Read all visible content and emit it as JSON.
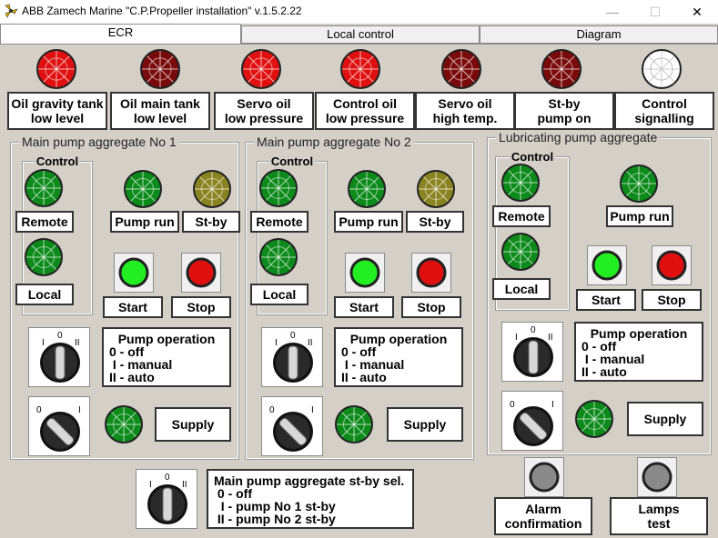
{
  "window": {
    "title": "ABB Zamech Marine \"C.P.Propeller installation\" v.1.5.2.22",
    "minimize": "—",
    "maximize": "☐",
    "close": "✕"
  },
  "tabs": [
    {
      "label": "ECR"
    },
    {
      "label": "Local control"
    },
    {
      "label": "Diagram"
    }
  ],
  "alarms": [
    {
      "label1": "Oil gravity tank",
      "label2": "low level",
      "color": "#e01010"
    },
    {
      "label1": "Oil main tank",
      "label2": "low level",
      "color": "#7a0a0a"
    },
    {
      "label1": "Servo oil",
      "label2": "low pressure",
      "color": "#e01010"
    },
    {
      "label1": "Control oil",
      "label2": "low pressure",
      "color": "#e01010"
    },
    {
      "label1": "Servo oil",
      "label2": "high temp.",
      "color": "#7a0a0a"
    },
    {
      "label1": "St-by",
      "label2": "pump on",
      "color": "#7a0a0a"
    },
    {
      "label1": "Control",
      "label2": "signalling",
      "color": "#ffffff"
    }
  ],
  "pump1": {
    "title": "Main pump aggregate No 1",
    "control": "Control",
    "remote": "Remote",
    "local": "Local",
    "pump_run": "Pump run",
    "stby": "St-by",
    "start": "Start",
    "stop": "Stop",
    "op_title": "Pump operation",
    "op_lines": [
      "0 - off",
      " I - manual",
      "II - auto"
    ],
    "supply": "Supply",
    "switch_labels": [
      "I",
      "0",
      "II"
    ],
    "switch2_labels": [
      "0",
      "I"
    ]
  },
  "pump2": {
    "title": "Main pump aggregate No 2",
    "control": "Control",
    "remote": "Remote",
    "local": "Local",
    "pump_run": "Pump run",
    "stby": "St-by",
    "start": "Start",
    "stop": "Stop",
    "op_title": "Pump operation",
    "op_lines": [
      "0 - off",
      " I - manual",
      "II - auto"
    ],
    "supply": "Supply",
    "switch_labels": [
      "I",
      "0",
      "II"
    ],
    "switch2_labels": [
      "0",
      "I"
    ]
  },
  "lube": {
    "title": "Lubricating pump aggregate",
    "control": "Control",
    "remote": "Remote",
    "local": "Local",
    "pump_run": "Pump run",
    "start": "Start",
    "stop": "Stop",
    "op_title": "Pump operation",
    "op_lines": [
      "0 - off",
      " I - manual",
      "II - auto"
    ],
    "supply": "Supply",
    "switch_labels": [
      "I",
      "0",
      "II"
    ],
    "switch2_labels": [
      "0",
      "I"
    ]
  },
  "stby_sel": {
    "title": "Main pump aggregate st-by sel.",
    "lines": [
      " 0 - off",
      "  I - pump No 1 st-by",
      " II - pump No 2 st-by"
    ],
    "switch_labels": [
      "I",
      "0",
      "II"
    ]
  },
  "bottom": {
    "alarm1": "Alarm",
    "alarm2": "confirmation",
    "lamps1": "Lamps",
    "lamps2": "test"
  },
  "colors": {
    "green": "#0c8a1a",
    "bright_green": "#22ee22",
    "olive": "#8a8420",
    "red_lamp": "#e01010",
    "grey_lamp": "#8a8a8a"
  }
}
